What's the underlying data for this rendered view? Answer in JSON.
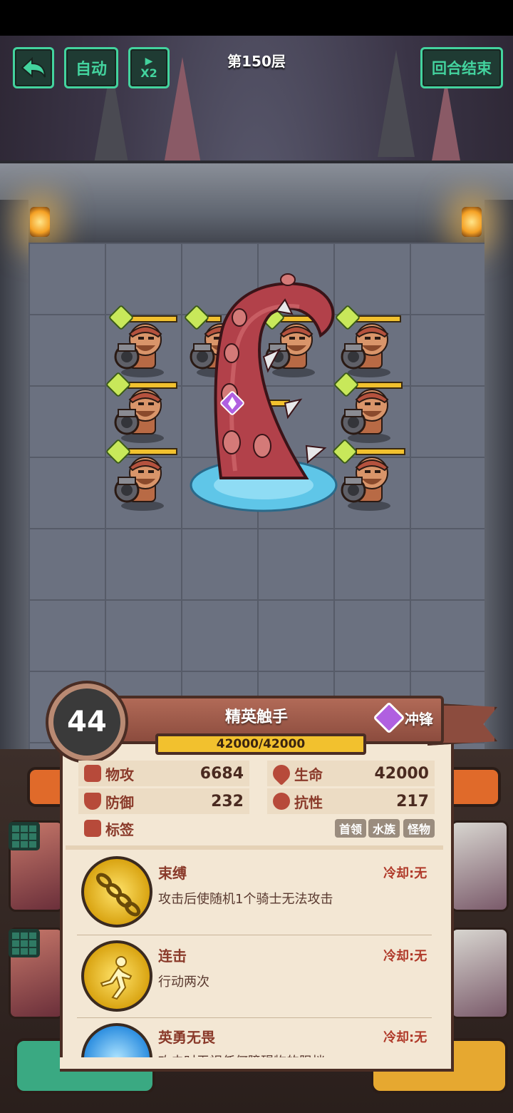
{
  "hud": {
    "back_icon": "back-arrow-icon",
    "auto_label": "自动",
    "speed_label": "X2",
    "floor_title": "第150层",
    "end_turn_label": "回合结束"
  },
  "enemy": {
    "level": "44",
    "name": "精英触手",
    "trait_label": "冲锋",
    "hp_text": "42000/42000",
    "stats": {
      "phys_atk_label": "物攻",
      "phys_atk_value": "6684",
      "hp_label": "生命",
      "hp_value": "42000",
      "defense_label": "防御",
      "defense_value": "232",
      "resist_label": "抗性",
      "resist_value": "217",
      "tags_label": "标签"
    },
    "tags": [
      "首领",
      "水族",
      "怪物"
    ],
    "skills": [
      {
        "name": "束缚",
        "cooldown": "冷却:无",
        "desc": "攻击后使随机1个骑士无法攻击",
        "icon": "chain-icon"
      },
      {
        "name": "连击",
        "cooldown": "冷却:无",
        "desc": "行动两次",
        "icon": "running-figure-icon"
      },
      {
        "name": "英勇无畏",
        "cooldown": "冷却:无",
        "desc": "攻击时无视任何障碍物的阻挡",
        "icon": "blue-orb-icon"
      }
    ]
  },
  "colors": {
    "hud_green": "#43d39e",
    "hp_yellow": "#f2c12e",
    "panel_bg": "#f3e7d4",
    "banner": "#8c4c3e"
  }
}
